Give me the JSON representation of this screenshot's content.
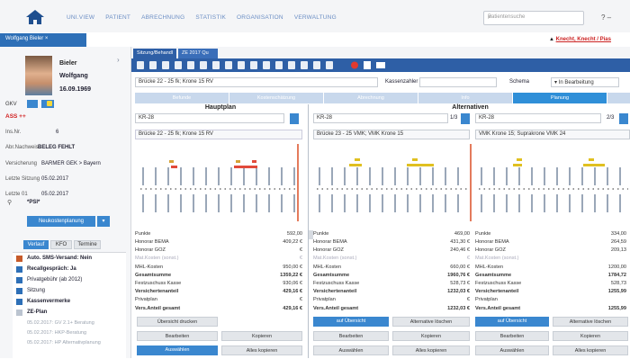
{
  "header": {
    "menu": [
      "UNI.VIEW",
      "PATIENT",
      "ABRECHNUNG",
      "STATISTIK",
      "ORGANISATION",
      "VERWALTUNG"
    ],
    "search_placeholder": "Patientensuche",
    "right_symbols": "?  –",
    "tab_label": "Wolfgang Bieler",
    "user_label": "Knecht, Knecht / Pias"
  },
  "patient": {
    "last_name": "Bieler",
    "first_name": "Wolfgang",
    "dob": "16.09.1969",
    "gkv_label": "GKV",
    "ass_label": "ASS ++",
    "fields": [
      {
        "label": "Ins.Nr.",
        "value": "6"
      },
      {
        "label": "Abr.Nachweis",
        "value": "BELEG FEHLT"
      },
      {
        "label": "Versicherung",
        "value": "BARMER GEK > Bayern"
      },
      {
        "label": "Letzte Sitzung",
        "value": "05.02.2017"
      },
      {
        "label": "Letzte 01",
        "value": "05.02.2017"
      }
    ],
    "psi_label": "*PSI*",
    "sidebar_button": "Neukostenplanung"
  },
  "sidebar_tabs": [
    "Verlauf",
    "KFO",
    "Termine"
  ],
  "sidebar_items": [
    "Auto. SMS-Versand: Nein",
    "Recallgespräch: Ja",
    "Privatgebühr (ab 2012)",
    "Sitzung",
    "Kassenvermerke",
    "ZE-Plan"
  ],
  "sidebar_history": [
    "05.02.2017: GV 2.1+ Beratung",
    "05.02.2017: HKP-Beratung",
    "05.02.2017: HP Alternativplanung"
  ],
  "content_tabs": [
    "Sitzung/Behandl",
    "ZE 2017 Qu"
  ],
  "planbar": {
    "plan_text": "Brücke 22 - 25 fk; Krone 15 RV",
    "kasse_label": "Kassenzahler",
    "schema_label": "Schema",
    "status_value": "In Bearbeitung"
  },
  "section_tabs": [
    "Befunde",
    "Kostenschätzung",
    "Abrechnung",
    "Info",
    "Planung"
  ],
  "panels": {
    "main_title": "Hauptplan",
    "alt_title": "Alternativen",
    "main": {
      "code": "KR-28",
      "plan": "Brücke 22 - 25 fk; Krone 15 RV",
      "counter": "",
      "rows": [
        {
          "label": "Punkte",
          "value": "592,00"
        },
        {
          "label": "Honorar BEMA",
          "value": "409,22 €"
        },
        {
          "label": "Honorar GOZ",
          "value": "€"
        },
        {
          "label": "Mat.Kosten (sonst.)",
          "value": "€"
        },
        {
          "label": "MHL-Kosten",
          "value": "950,00 €"
        },
        {
          "label": "Gesamtsumme",
          "value": "1359,22 €"
        },
        {
          "label": "Festzuschuss Kasse",
          "value": "930,06 €"
        },
        {
          "label": "Versichertenanteil",
          "value": "429,16 €"
        },
        {
          "label": "Privatplan",
          "value": "€"
        },
        {
          "label": "Vers.Anteil gesamt",
          "value": "429,16 €"
        }
      ],
      "buttons": [
        "Übersicht drucken",
        "Bearbeiten",
        "Kopieren",
        "Auswählen",
        "Alles kopieren"
      ]
    },
    "alt1": {
      "code": "KR-28",
      "plan": "Brücke 23 - 25 VMK; VMK Krone 15",
      "counter": "1/3",
      "rows": [
        {
          "label": "Punkte",
          "value": "469,00"
        },
        {
          "label": "Honorar BEMA",
          "value": "431,30 €"
        },
        {
          "label": "Honorar GOZ",
          "value": "240,46 €"
        },
        {
          "label": "Mat.Kosten (sonst.)",
          "value": "€"
        },
        {
          "label": "MHL-Kosten",
          "value": "660,00 €"
        },
        {
          "label": "Gesamtsumme",
          "value": "1960,76 €"
        },
        {
          "label": "Festzuschuss Kasse",
          "value": "528,73 €"
        },
        {
          "label": "Versichertenanteil",
          "value": "1232,03 €"
        },
        {
          "label": "Privatplan",
          "value": "€"
        },
        {
          "label": "Vers.Anteil gesamt",
          "value": "1232,03 €"
        }
      ],
      "buttons": [
        "auf Übersicht",
        "Alternative löschen",
        "Bearbeiten",
        "Kopieren",
        "Auswählen",
        "Alles kopieren"
      ]
    },
    "alt2": {
      "code": "KR-28",
      "plan": "VMK Krone 15; Suprakrone VMK 24",
      "counter": "2/3",
      "rows": [
        {
          "label": "Punkte",
          "value": "334,00"
        },
        {
          "label": "Honorar BEMA",
          "value": "264,59"
        },
        {
          "label": "Honorar GOZ",
          "value": "209,13"
        },
        {
          "label": "Mat.Kosten (sonst.)",
          "value": ""
        },
        {
          "label": "MHL-Kosten",
          "value": "1200,00"
        },
        {
          "label": "Gesamtsumme",
          "value": "1784,72"
        },
        {
          "label": "Festzuschuss Kasse",
          "value": "528,73"
        },
        {
          "label": "Versichertenanteil",
          "value": "1255,99"
        },
        {
          "label": "Privatplan",
          "value": ""
        },
        {
          "label": "Vers.Anteil gesamt",
          "value": "1255,99"
        }
      ],
      "buttons": [
        "auf Übersicht",
        "Alternative löschen",
        "Bearbeiten",
        "Kopieren",
        "Auswählen",
        "Alles kopieren"
      ]
    }
  }
}
